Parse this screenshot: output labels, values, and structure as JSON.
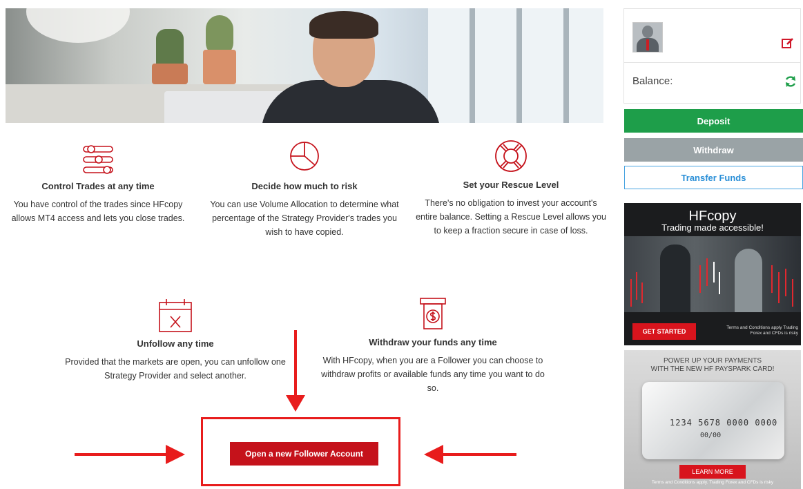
{
  "features": [
    {
      "title": "Control Trades at any time",
      "text": "You have control of the trades since HFcopy allows MT4 access and lets you close trades.",
      "icon": "sliders-icon"
    },
    {
      "title": "Decide how much to risk",
      "text": "You can use Volume Allocation to determine what percentage of the Strategy Provider's trades you wish to have copied.",
      "icon": "pie-chart-icon"
    },
    {
      "title": "Set your Rescue Level",
      "text": "There's no obligation to invest your account's entire balance. Setting a Rescue Level allows you to keep a fraction secure in case of loss.",
      "icon": "lifebuoy-icon"
    },
    {
      "title": "Unfollow any time",
      "text": "Provided that the markets are open, you can unfollow one Strategy Provider and select another.",
      "icon": "calendar-x-icon"
    },
    {
      "title": "Withdraw your funds any time",
      "text": "With HFcopy, when you are a Follower you can choose to withdraw profits or available funds any time you want to do so.",
      "icon": "atm-withdraw-icon"
    }
  ],
  "cta": {
    "label": "Open a new Follower Account"
  },
  "account": {
    "balance_label": "Balance:",
    "edit_icon": "edit-icon",
    "refresh_icon": "refresh-icon",
    "deposit_label": "Deposit",
    "withdraw_label": "Withdraw",
    "transfer_label": "Transfer Funds"
  },
  "ads": {
    "hfcopy": {
      "title": "HFcopy",
      "subtitle": "Trading made accessible!",
      "button": "GET STARTED",
      "terms": "Terms and Conditions apply Trading Forex and CFDs is risky"
    },
    "payspark": {
      "title_line1": "POWER UP YOUR PAYMENTS",
      "title_line2": "WITH THE NEW HF PAYSPARK CARD!",
      "card_number": "1234 5678 0000 0000",
      "card_expiry": "00/00",
      "button": "LEARN MORE",
      "terms": "Terms and Conditions apply. Trading Forex and CFDs is risky"
    }
  },
  "colors": {
    "brand_red": "#c5121b",
    "highlight_red": "#e81c1c",
    "deposit_green": "#1e9e4a",
    "withdraw_gray": "#9aa3a6",
    "transfer_blue": "#2a8fd7"
  }
}
